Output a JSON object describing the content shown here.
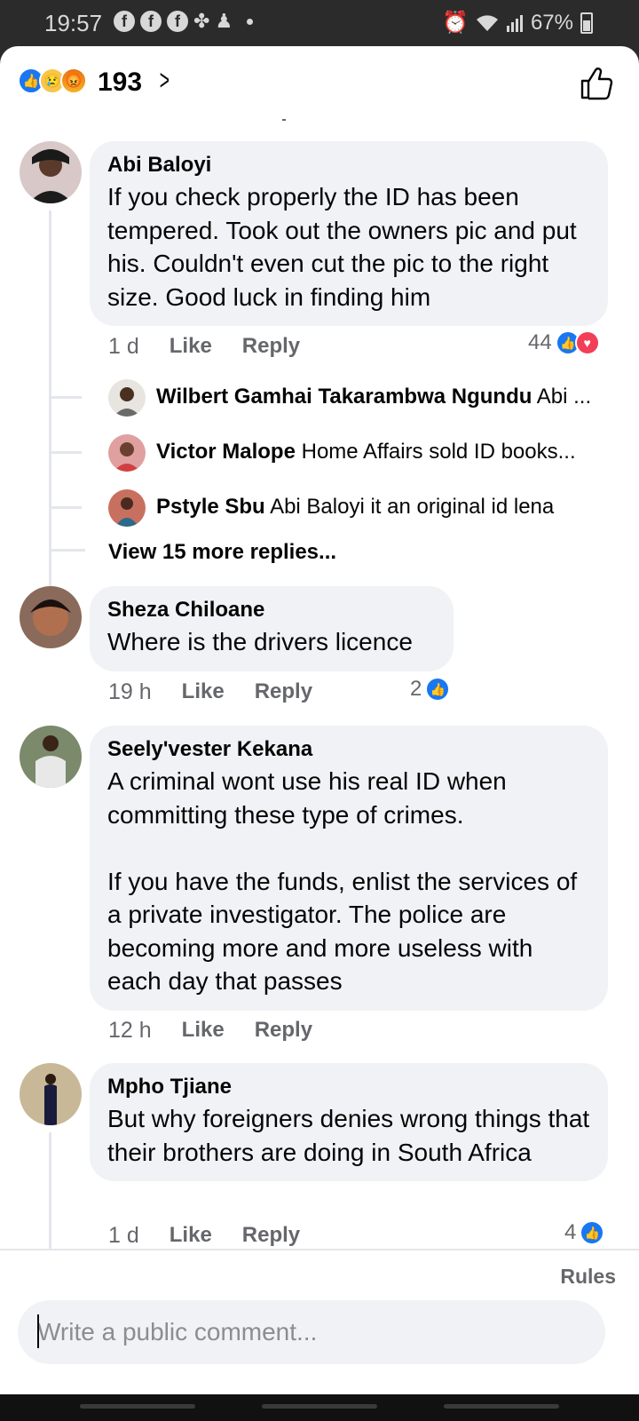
{
  "status_bar": {
    "time": "19:57",
    "battery": "67%"
  },
  "reactions": {
    "count": "193"
  },
  "comments": [
    {
      "name": "Abi Baloyi",
      "text": "If you check properly the ID has been tempered. Took out the owners pic and put his. Couldn't even cut the pic to the right size. Good luck in finding him",
      "time": "1 d",
      "like": "Like",
      "reply": "Reply",
      "reaction_count": "44",
      "replies": [
        {
          "name": "Wilbert Gamhai Takarambwa Ngundu",
          "text": "Abi ..."
        },
        {
          "name": "Victor Malope",
          "text": "Home Affairs sold ID books..."
        },
        {
          "name": "Pstyle Sbu",
          "text": "Abi Baloyi it an original id   lena"
        }
      ],
      "view_more": "View 15 more replies..."
    },
    {
      "name": "Sheza Chiloane",
      "text": "Where is the drivers licence",
      "time": "19 h",
      "like": "Like",
      "reply": "Reply",
      "reaction_count": "2"
    },
    {
      "name": "Seely'vester Kekana",
      "text": "A criminal wont use his real ID when committing these type of crimes.\n\nIf you have the funds, enlist the services of a private investigator. The police are becoming more and more useless with each day that passes",
      "time": "12 h",
      "like": "Like",
      "reply": "Reply"
    },
    {
      "name": "Mpho Tjiane",
      "text": "But why foreigners denies wrong things that their brothers are doing in South Africa",
      "time": "1 d",
      "like": "Like",
      "reply": "Reply",
      "reaction_count": "4"
    }
  ],
  "composer": {
    "rules": "Rules",
    "placeholder": "Write a public comment..."
  },
  "colors": {
    "accent": "#1877f2",
    "bubble": "#f0f2f5",
    "muted": "#65676b"
  }
}
